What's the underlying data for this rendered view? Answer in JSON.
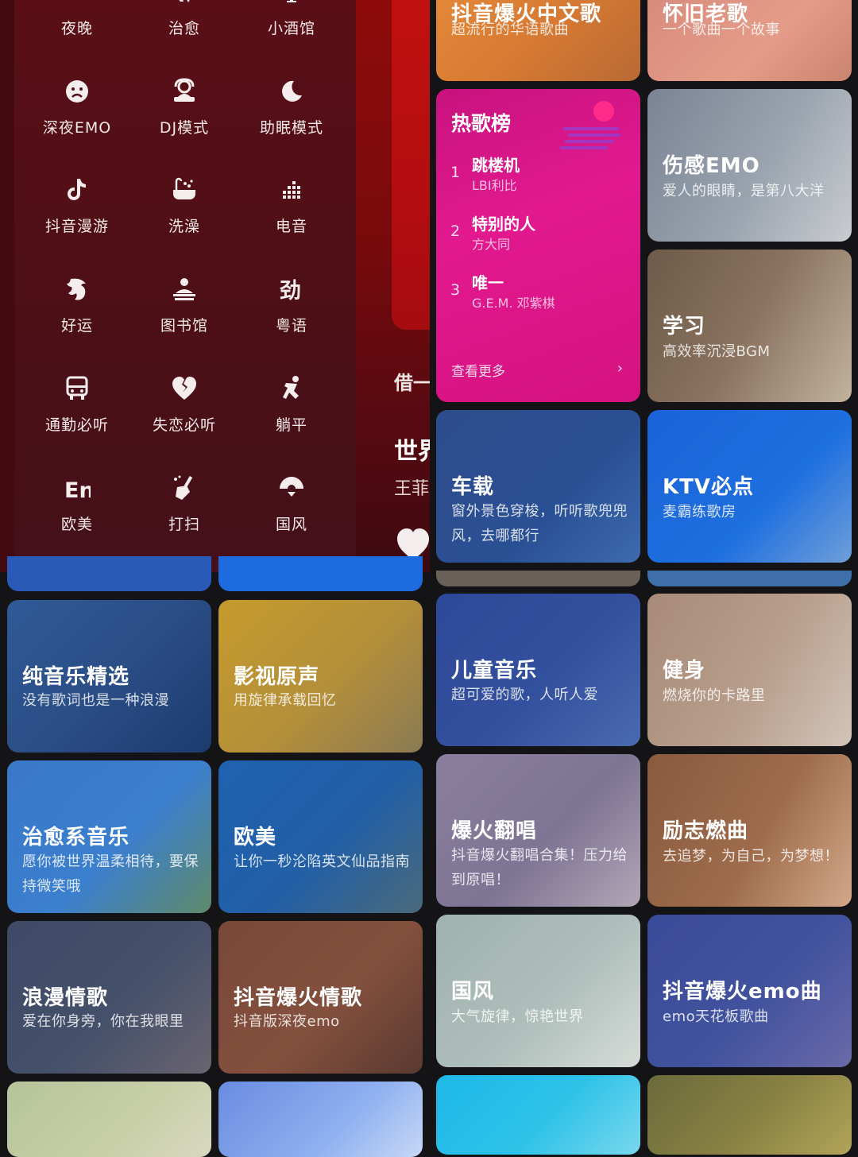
{
  "moods": [
    {
      "label": "夜晚",
      "icon": "night-icon"
    },
    {
      "label": "治愈",
      "icon": "healing-icon"
    },
    {
      "label": "小酒馆",
      "icon": "tavern-icon"
    },
    {
      "label": "深夜EMO",
      "icon": "sad-face-icon"
    },
    {
      "label": "DJ模式",
      "icon": "dj-icon"
    },
    {
      "label": "助眠模式",
      "icon": "moon-sleep-icon"
    },
    {
      "label": "抖音漫游",
      "icon": "tiktok-icon"
    },
    {
      "label": "洗澡",
      "icon": "bathtub-icon"
    },
    {
      "label": "电音",
      "icon": "equalizer-icon"
    },
    {
      "label": "好运",
      "icon": "lucky-icon"
    },
    {
      "label": "图书馆",
      "icon": "library-icon"
    },
    {
      "label": "粤语",
      "icon": "cantonese-icon"
    },
    {
      "label": "通勤必听",
      "icon": "bus-icon"
    },
    {
      "label": "失恋必听",
      "icon": "broken-heart-icon"
    },
    {
      "label": "躺平",
      "icon": "lying-flat-icon"
    },
    {
      "label": "欧美",
      "icon": "en-icon"
    },
    {
      "label": "打扫",
      "icon": "broom-icon"
    },
    {
      "label": "国风",
      "icon": "chinese-fan-icon"
    }
  ],
  "side_player": {
    "line1": "借一",
    "line2": "世界",
    "line3": "王菲"
  },
  "hot_chart": {
    "title": "热歌榜",
    "items": [
      {
        "rank": "1",
        "song": "跳楼机",
        "artist": "LBI利比"
      },
      {
        "rank": "2",
        "song": "特别的人",
        "artist": "方大同"
      },
      {
        "rank": "3",
        "song": "唯一",
        "artist": "G.E.M. 邓紫棋"
      }
    ],
    "more_label": "查看更多"
  },
  "cards": {
    "douyin_chinese": {
      "title": "抖音爆火中文歌",
      "subtitle": "超流行的华语歌曲"
    },
    "old_songs": {
      "title": "怀旧老歌",
      "subtitle": "一个歌曲一个故事"
    },
    "sad_emo": {
      "title": "伤感EMO",
      "subtitle": "爱人的眼睛，是第八大洋"
    },
    "study": {
      "title": "学习",
      "subtitle": "高效率沉浸BGM"
    },
    "car": {
      "title": "车载",
      "subtitle": "窗外景色穿梭，听听歌兜兜风，去哪都行"
    },
    "ktv": {
      "title": "KTV必点",
      "subtitle": "麦霸练歌房"
    },
    "pure_music": {
      "title": "纯音乐精选",
      "subtitle": "没有歌词也是一种浪漫"
    },
    "film_ost": {
      "title": "影视原声",
      "subtitle": "用旋律承载回忆"
    },
    "kids": {
      "title": "儿童音乐",
      "subtitle": "超可爱的歌，人听人爱"
    },
    "fitness": {
      "title": "健身",
      "subtitle": "燃烧你的卡路里"
    },
    "healing_music": {
      "title": "治愈系音乐",
      "subtitle": "愿你被世界温柔相待，要保持微笑哦"
    },
    "western": {
      "title": "欧美",
      "subtitle": "让你一秒沦陷英文仙品指南"
    },
    "covers": {
      "title": "爆火翻唱",
      "subtitle": "抖音爆火翻唱合集！压力给到原唱！"
    },
    "inspiring": {
      "title": "励志燃曲",
      "subtitle": "去追梦，为自己，为梦想！"
    },
    "romance": {
      "title": "浪漫情歌",
      "subtitle": "爱在你身旁，你在我眼里"
    },
    "douyin_love": {
      "title": "抖音爆火情歌",
      "subtitle": "抖音版深夜emo"
    },
    "guofeng": {
      "title": "国风",
      "subtitle": "大气旋律，惊艳世界"
    },
    "douyin_emo": {
      "title": "抖音爆火emo曲",
      "subtitle": "emo天花板歌曲"
    }
  },
  "colors": {
    "panel_bg": "#4e0f16",
    "hot_chart_pink": "#e0158f",
    "background": "#141416"
  }
}
